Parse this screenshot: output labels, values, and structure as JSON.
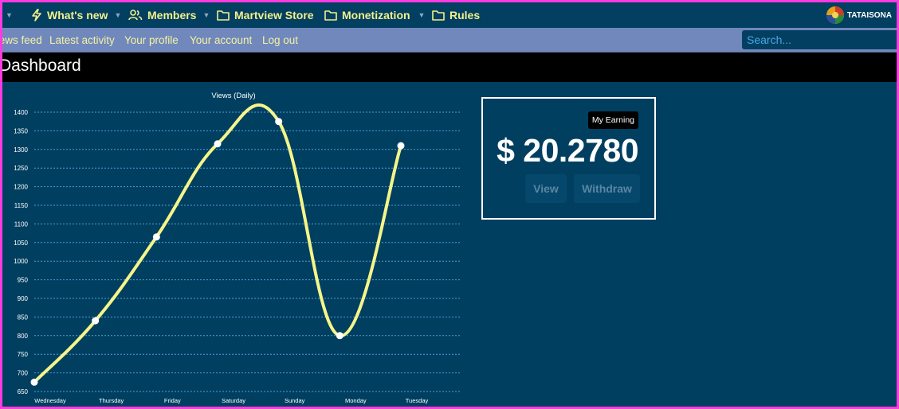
{
  "topnav": {
    "items": [
      {
        "label": "What's new",
        "icon": "bolt-icon",
        "dropdown": true
      },
      {
        "label": "Members",
        "icon": "users-icon",
        "dropdown": true
      },
      {
        "label": "Martview Store",
        "icon": "folder-icon",
        "dropdown": false
      },
      {
        "label": "Monetization",
        "icon": "folder-icon",
        "dropdown": true
      },
      {
        "label": "Rules",
        "icon": "folder-icon",
        "dropdown": false
      }
    ],
    "brand": "TATAISONA"
  },
  "subnav": {
    "items": [
      "News feed",
      "Latest activity",
      "Your profile",
      "Your account",
      "Log out"
    ],
    "search_placeholder": "Search..."
  },
  "page": {
    "title": "Dashboard"
  },
  "earnings": {
    "badge": "My Earning",
    "amount": "$ 20.2780",
    "view_label": "View",
    "withdraw_label": "Withdraw"
  },
  "colors": {
    "line": "#f6f58a",
    "grid": "#4a9fd8",
    "point": "#ffffff",
    "nav_bg": "#023f61",
    "subnav_bg": "#7188bd",
    "page_bg": "#003f60"
  },
  "chart_data": {
    "type": "line",
    "title": "Views (Daily)",
    "categories": [
      "Wednesday",
      "Thursday",
      "Friday",
      "Saturday",
      "Sunday",
      "Monday",
      "Tuesday"
    ],
    "values": [
      675,
      840,
      1065,
      1315,
      1375,
      800,
      1310
    ],
    "ylim": [
      650,
      1400
    ],
    "yticks": [
      650,
      700,
      750,
      800,
      850,
      900,
      950,
      1000,
      1050,
      1100,
      1150,
      1200,
      1250,
      1300,
      1350,
      1400
    ],
    "grid": true,
    "smooth": true
  }
}
